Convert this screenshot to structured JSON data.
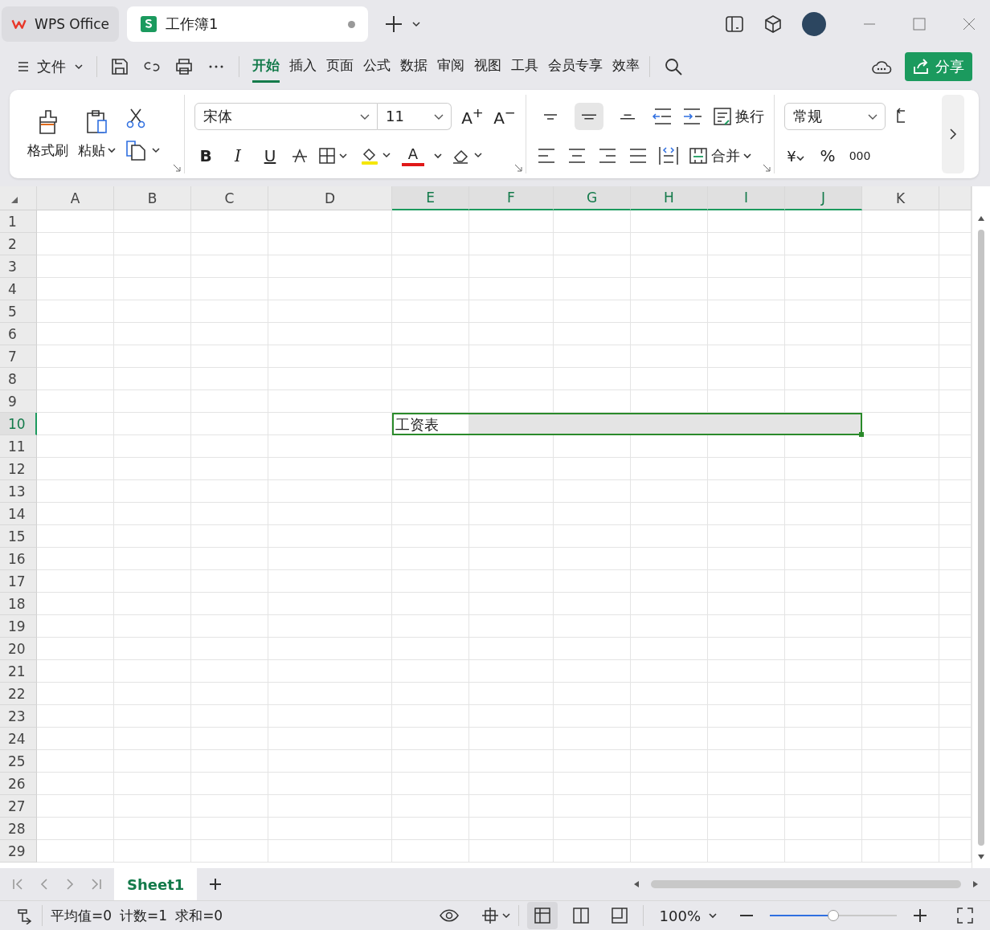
{
  "window": {
    "tabs": [
      {
        "label": "WPS Office",
        "kind": "home",
        "selected": false
      },
      {
        "label": "工作簿1",
        "kind": "sheet",
        "selected": true,
        "modified": true
      }
    ]
  },
  "menu": {
    "file": "文件",
    "tabs": [
      {
        "label": "开始",
        "selected": true
      },
      {
        "label": "插入",
        "selected": false
      },
      {
        "label": "页面",
        "selected": false
      },
      {
        "label": "公式",
        "selected": false
      },
      {
        "label": "数据",
        "selected": false
      },
      {
        "label": "审阅",
        "selected": false
      },
      {
        "label": "视图",
        "selected": false
      },
      {
        "label": "工具",
        "selected": false
      },
      {
        "label": "会员专享",
        "selected": false
      },
      {
        "label": "效率",
        "selected": false
      }
    ],
    "share": "分享"
  },
  "ribbon": {
    "format_painter": "格式刷",
    "paste": "粘贴",
    "font": "宋体",
    "size": "11",
    "grow": "A$^{+}$",
    "shrink": "A$^{−}$",
    "bold": "B",
    "italic": "I",
    "underline": "U",
    "font_color": "A",
    "wrap": "换行",
    "merge": "合并",
    "number_format": "常规",
    "currency": "¥",
    "percent": "%",
    "thousands": "000",
    "valign": [
      {
        "kind": "top",
        "selected": false
      },
      {
        "kind": "middle",
        "selected": true
      },
      {
        "kind": "bottom",
        "selected": false
      }
    ]
  },
  "grid": {
    "columns": [
      {
        "label": "A",
        "selected": false
      },
      {
        "label": "B",
        "selected": false
      },
      {
        "label": "C",
        "selected": false
      },
      {
        "label": "D",
        "selected": false
      },
      {
        "label": "E",
        "selected": true
      },
      {
        "label": "F",
        "selected": true
      },
      {
        "label": "G",
        "selected": true
      },
      {
        "label": "H",
        "selected": true
      },
      {
        "label": "I",
        "selected": true
      },
      {
        "label": "J",
        "selected": true
      },
      {
        "label": "K",
        "selected": false
      }
    ],
    "rows": [
      {
        "label": "1",
        "selected": false
      },
      {
        "label": "2",
        "selected": false
      },
      {
        "label": "3",
        "selected": false
      },
      {
        "label": "4",
        "selected": false
      },
      {
        "label": "5",
        "selected": false
      },
      {
        "label": "6",
        "selected": false
      },
      {
        "label": "7",
        "selected": false
      },
      {
        "label": "8",
        "selected": false
      },
      {
        "label": "9",
        "selected": false
      },
      {
        "label": "10",
        "selected": true
      },
      {
        "label": "11",
        "selected": false
      },
      {
        "label": "12",
        "selected": false
      },
      {
        "label": "13",
        "selected": false
      },
      {
        "label": "14",
        "selected": false
      },
      {
        "label": "15",
        "selected": false
      },
      {
        "label": "16",
        "selected": false
      },
      {
        "label": "17",
        "selected": false
      },
      {
        "label": "18",
        "selected": false
      },
      {
        "label": "19",
        "selected": false
      },
      {
        "label": "20",
        "selected": false
      },
      {
        "label": "21",
        "selected": false
      },
      {
        "label": "22",
        "selected": false
      },
      {
        "label": "23",
        "selected": false
      },
      {
        "label": "24",
        "selected": false
      },
      {
        "label": "25",
        "selected": false
      },
      {
        "label": "26",
        "selected": false
      },
      {
        "label": "27",
        "selected": false
      },
      {
        "label": "28",
        "selected": false
      },
      {
        "label": "29",
        "selected": false
      }
    ],
    "active_cell_text": "工资表"
  },
  "sheets": [
    {
      "label": "Sheet1",
      "selected": true
    }
  ],
  "status": {
    "average": "平均值=0",
    "count": "计数=1",
    "sum": "求和=0",
    "zoom": "100%",
    "zoom_slider": {
      "level": 0.5
    }
  }
}
